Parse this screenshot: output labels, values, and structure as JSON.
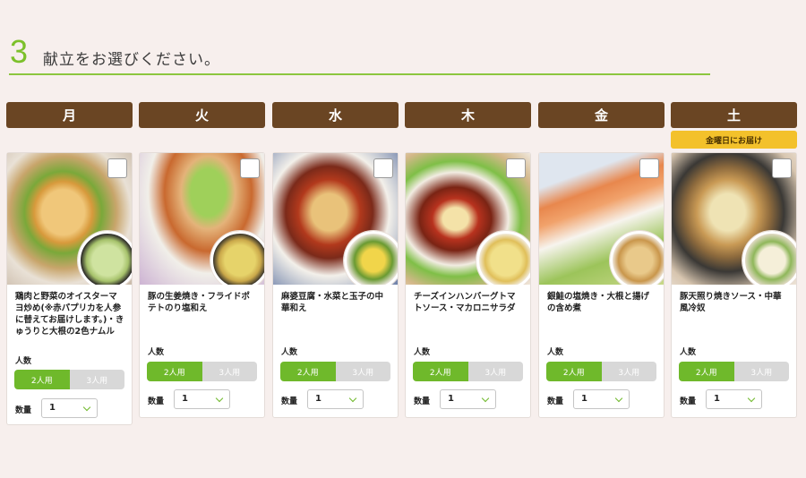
{
  "step": {
    "number": "3",
    "title": "献立をお選びください。"
  },
  "days": [
    "月",
    "火",
    "水",
    "木",
    "金",
    "土"
  ],
  "delivery_badge": "金曜日にお届け",
  "labels": {
    "servings": "人数",
    "quantity": "数量"
  },
  "serving_options": [
    "2人用",
    "3人用"
  ],
  "cards": [
    {
      "name": "鶏肉と野菜のオイスターマヨ炒め(※赤パプリカを人参に替えてお届けします。)・きゅうりと大根の2色ナムル",
      "servings": "2人用",
      "quantity": "1"
    },
    {
      "name": "豚の生姜焼き・フライドポテトのり塩和え",
      "servings": "2人用",
      "quantity": "1"
    },
    {
      "name": "麻婆豆腐・水菜と玉子の中華和え",
      "servings": "2人用",
      "quantity": "1"
    },
    {
      "name": "チーズインハンバーグトマトソース・マカロニサラダ",
      "servings": "2人用",
      "quantity": "1"
    },
    {
      "name": "銀鮭の塩焼き・大根と揚げの含め煮",
      "servings": "2人用",
      "quantity": "1"
    },
    {
      "name": "豚天照り焼きソース・中華風冷奴",
      "servings": "2人用",
      "quantity": "1"
    }
  ],
  "colors": {
    "accent_green": "#6fb92b",
    "day_brown": "#6a4523",
    "badge_yellow": "#f3c12b"
  }
}
